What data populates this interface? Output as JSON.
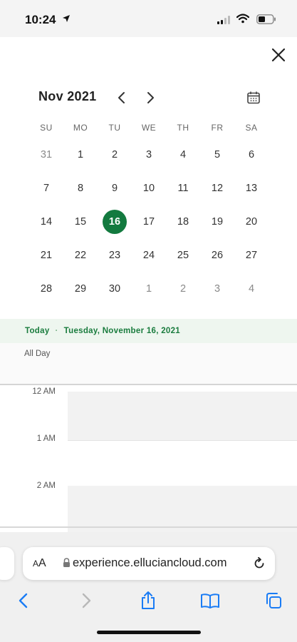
{
  "status_bar": {
    "time": "10:24"
  },
  "calendar": {
    "month_title": "Nov 2021",
    "weekdays": [
      "SU",
      "MO",
      "TU",
      "WE",
      "TH",
      "FR",
      "SA"
    ],
    "weeks": [
      [
        {
          "d": "31",
          "other": true
        },
        {
          "d": "1"
        },
        {
          "d": "2"
        },
        {
          "d": "3"
        },
        {
          "d": "4"
        },
        {
          "d": "5"
        },
        {
          "d": "6"
        }
      ],
      [
        {
          "d": "7"
        },
        {
          "d": "8"
        },
        {
          "d": "9"
        },
        {
          "d": "10"
        },
        {
          "d": "11"
        },
        {
          "d": "12"
        },
        {
          "d": "13"
        }
      ],
      [
        {
          "d": "14"
        },
        {
          "d": "15"
        },
        {
          "d": "16",
          "selected": true
        },
        {
          "d": "17"
        },
        {
          "d": "18"
        },
        {
          "d": "19"
        },
        {
          "d": "20"
        }
      ],
      [
        {
          "d": "21"
        },
        {
          "d": "22"
        },
        {
          "d": "23"
        },
        {
          "d": "24"
        },
        {
          "d": "25"
        },
        {
          "d": "26"
        },
        {
          "d": "27"
        }
      ],
      [
        {
          "d": "28"
        },
        {
          "d": "29"
        },
        {
          "d": "30"
        },
        {
          "d": "1",
          "other": true
        },
        {
          "d": "2",
          "other": true
        },
        {
          "d": "3",
          "other": true
        },
        {
          "d": "4",
          "other": true
        }
      ]
    ]
  },
  "day_view": {
    "today_label": "Today",
    "separator": "·",
    "date_label": "Tuesday, November 16, 2021",
    "all_day_label": "All Day",
    "hours": [
      "12 AM",
      "1 AM",
      "2 AM"
    ]
  },
  "browser": {
    "text_size_label": "A",
    "text_size_small": "A",
    "url": "experience.elluciancloud.com"
  },
  "colors": {
    "accent": "#137a3f",
    "ios_blue": "#1a7cf5"
  },
  "icons": [
    "location-arrow-icon",
    "signal-icon",
    "wifi-icon",
    "battery-icon",
    "close-icon",
    "chevron-left-icon",
    "chevron-right-icon",
    "calendar-icon",
    "lock-icon",
    "reload-icon",
    "back-icon",
    "forward-icon",
    "share-icon",
    "bookmarks-icon",
    "tabs-icon"
  ]
}
